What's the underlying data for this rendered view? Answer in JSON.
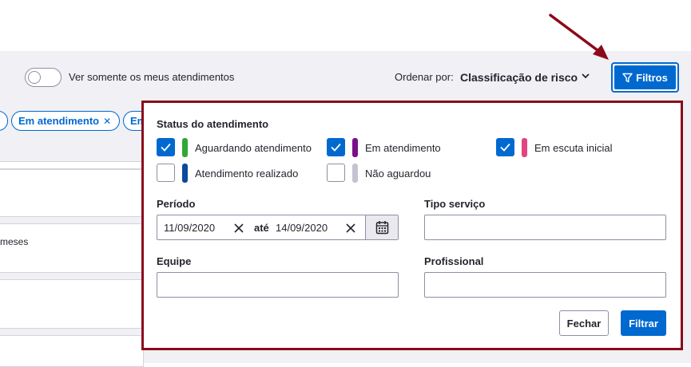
{
  "toolbar": {
    "toggle_label": "Ver somente os meus atendimentos",
    "order_label": "Ordenar por:",
    "order_value": "Classificação de risco",
    "filter_button_label": "Filtros"
  },
  "chips": [
    {
      "label": "Em atendimento"
    },
    {
      "label": "Em"
    }
  ],
  "list": {
    "partial_text": "meses"
  },
  "filter_panel": {
    "status_title": "Status do atendimento",
    "statuses": [
      {
        "label": "Aguardando atendimento",
        "checked": true,
        "color": "#2fa836"
      },
      {
        "label": "Em atendimento",
        "checked": true,
        "color": "#7a0f8a"
      },
      {
        "label": "Em escuta inicial",
        "checked": true,
        "color": "#e0457f"
      },
      {
        "label": "Atendimento realizado",
        "checked": false,
        "color": "#0b4a9c"
      },
      {
        "label": "Não aguardou",
        "checked": false,
        "color": "#c3c4cf"
      }
    ],
    "periodo_label": "Período",
    "date_from": "11/09/2020",
    "date_sep": "até",
    "date_to": "14/09/2020",
    "tipo_servico_label": "Tipo serviço",
    "equipe_label": "Equipe",
    "profissional_label": "Profissional",
    "close_label": "Fechar",
    "apply_label": "Filtrar"
  },
  "colors": {
    "primary": "#0069d0",
    "highlight_border": "#8b0a1a",
    "background_grey": "#f0f0f5"
  }
}
